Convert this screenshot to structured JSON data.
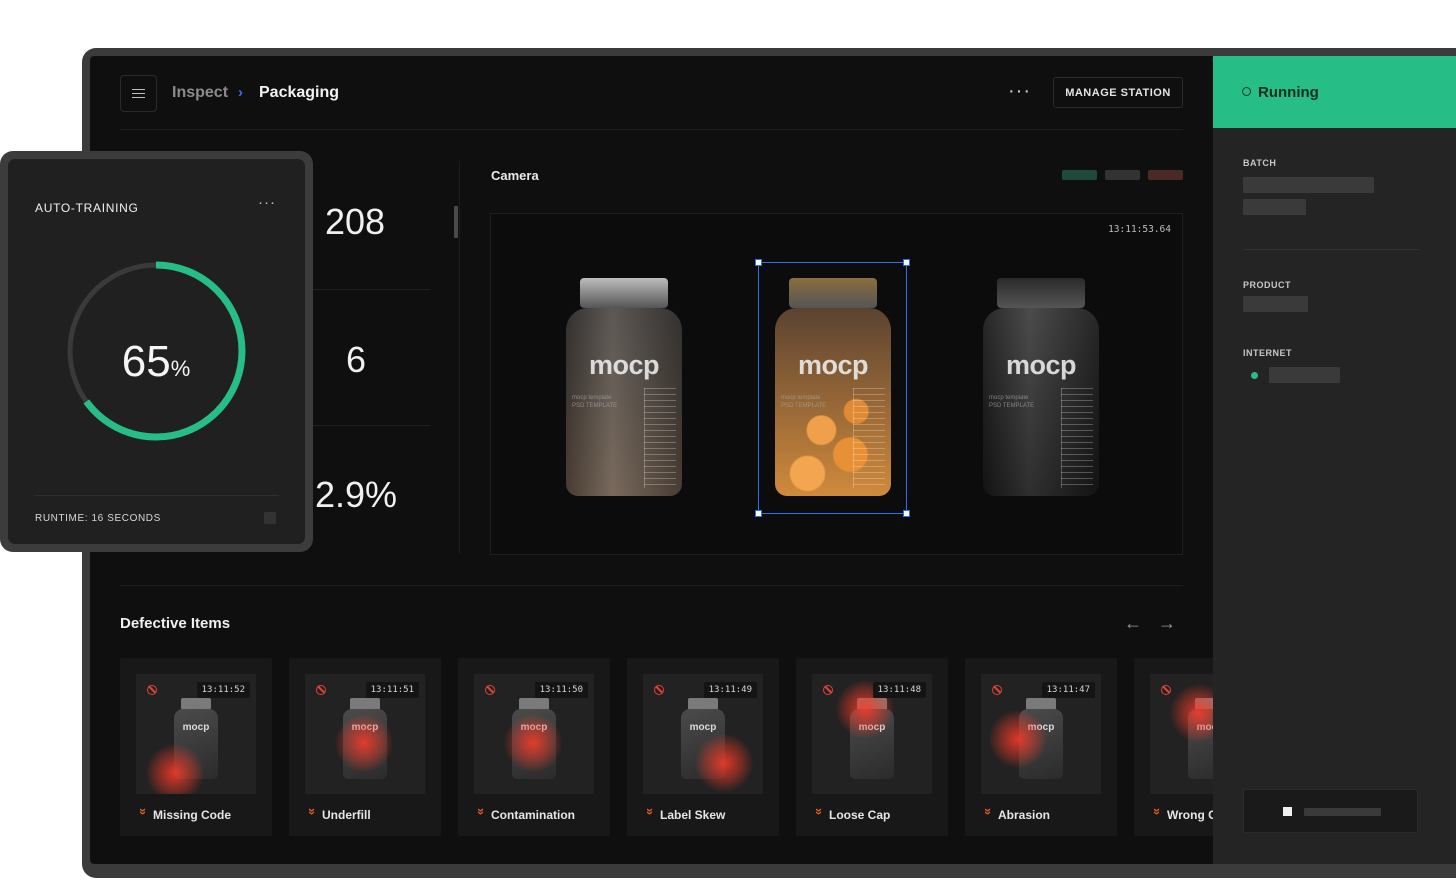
{
  "header": {
    "breadcrumb": [
      "Inspect",
      "Packaging"
    ],
    "separator": "›",
    "more_label": "···",
    "manage_button": "MANAGE STATION"
  },
  "stats": [
    "208",
    "6",
    "2.9%"
  ],
  "camera": {
    "title": "Camera",
    "timestamp": "13:11:53.64",
    "legend_colors": [
      "#1f4a3a",
      "#333333",
      "#4a2a24"
    ],
    "bottles": [
      {
        "brand": "mocp",
        "cap": "#bdbdbd",
        "body": "#4e4a47",
        "tint": "#6e5d4e"
      },
      {
        "brand": "mocp",
        "cap": "#8a6e3e",
        "body": "#6b4a2c",
        "tint": "#d08a3c",
        "selected": true
      },
      {
        "brand": "mocp",
        "cap": "#2a2a2a",
        "body": "#3c3c3c",
        "tint": "#1d1d1d"
      }
    ],
    "bottle_subtext": [
      "mocp template",
      "PSD TEMPLATE"
    ]
  },
  "defective": {
    "title": "Defective Items",
    "prev_arrow": "←",
    "next_arrow": "→",
    "items": [
      {
        "time": "13:11:52",
        "label": "Missing Code",
        "icon": "ban-icon",
        "glow": "bottom-left"
      },
      {
        "time": "13:11:51",
        "label": "Underfill",
        "icon": "ban-icon",
        "glow": "center"
      },
      {
        "time": "13:11:50",
        "label": "Contamination",
        "icon": "ban-icon",
        "glow": "center"
      },
      {
        "time": "13:11:49",
        "label": "Label Skew",
        "icon": "ban-icon",
        "glow": "bottom-right"
      },
      {
        "time": "13:11:48",
        "label": "Loose Cap",
        "icon": "ban-icon",
        "glow": "top"
      },
      {
        "time": "13:11:47",
        "label": "Abrasion",
        "icon": "ban-icon",
        "glow": "left"
      },
      {
        "time": "",
        "label": "Wrong C",
        "icon": "ban-icon",
        "glow": "top-left"
      }
    ]
  },
  "status_panel": {
    "status": "Running",
    "accent": "#26bd86",
    "batch_label": "BATCH",
    "product_label": "PRODUCT",
    "internet_label": "INTERNET"
  },
  "auto_training": {
    "title": "AUTO-TRAINING",
    "more_label": "···",
    "progress_value": "65",
    "progress_unit": "%",
    "progress": 0.65,
    "runtime": "RUNTIME: 16 SECONDS",
    "ring_color": "#26bd86"
  }
}
